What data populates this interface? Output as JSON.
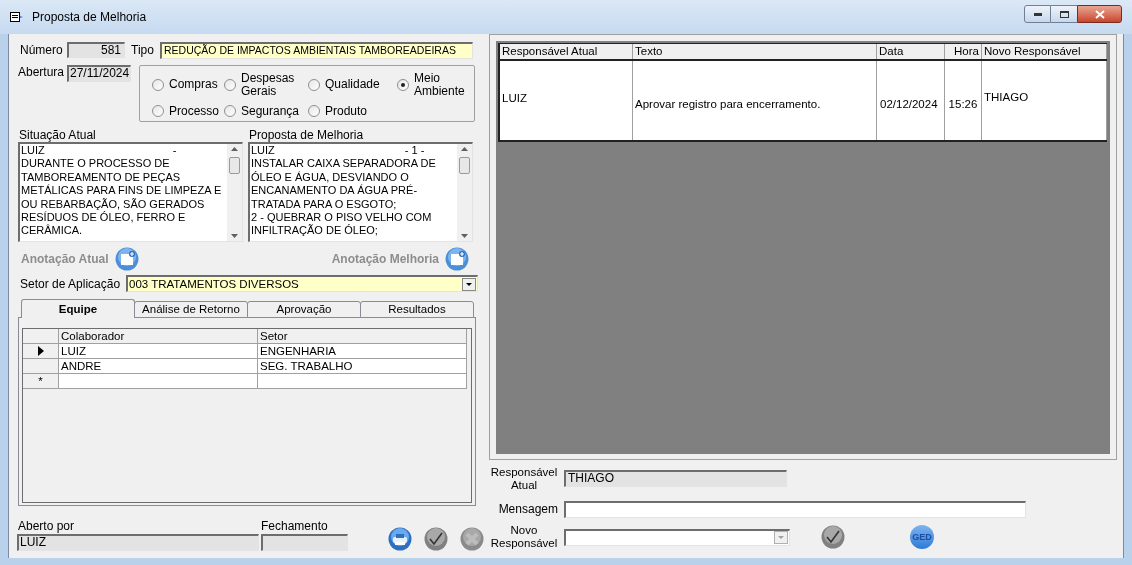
{
  "window": {
    "title": "Proposta de Melhoria"
  },
  "numero": {
    "label": "Número",
    "value": "581"
  },
  "tipo": {
    "label": "Tipo",
    "value": "REDUÇÃO DE IMPACTOS AMBIENTAIS TAMBOREADEIRAS"
  },
  "abertura": {
    "label": "Abertura",
    "value": "27/11/2024"
  },
  "categories": [
    {
      "label": "Compras",
      "selected": false
    },
    {
      "label": "Despesas Gerais",
      "selected": false
    },
    {
      "label": "Qualidade",
      "selected": false
    },
    {
      "label": "Meio Ambiente",
      "selected": true
    },
    {
      "label": "Processo",
      "selected": false
    },
    {
      "label": "Segurança",
      "selected": false
    },
    {
      "label": "Produto",
      "selected": false
    }
  ],
  "notes": [
    {
      "label": "Situação Atual",
      "author": "LUIZ",
      "marker": "-",
      "lines": [
        "DURANTE O PROCESSO DE",
        "TAMBOREAMENTO DE PEÇAS",
        "METÁLICAS PARA FINS DE LIMPEZA E",
        "OU REBARBAÇÃO, SÃO GERADOS",
        "RESÍDUOS DE ÓLEO, FERRO E",
        "CERÂMICA."
      ],
      "annotation": "Anotação Atual"
    },
    {
      "label": "Proposta de Melhoria",
      "author": "LUIZ",
      "marker": "- 1 -",
      "lines": [
        "INSTALAR CAIXA SEPARADORA DE",
        "ÓLEO E ÁGUA, DESVIANDO O",
        "ENCANAMENTO DA ÁGUA PRÉ-",
        "TRATADA PARA O ESGOTO;",
        "2 - QUEBRAR O PISO VELHO COM",
        "INFILTRAÇÃO DE ÓLEO;"
      ],
      "annotation": "Anotação Melhoria"
    }
  ],
  "setor": {
    "label": "Setor de Aplicação",
    "value": "003 TRATAMENTOS DIVERSOS"
  },
  "tabs": [
    {
      "label": "Equipe",
      "selected": true
    },
    {
      "label": "Análise de Retorno",
      "selected": false
    },
    {
      "label": "Aprovação",
      "selected": false
    },
    {
      "label": "Resultados",
      "selected": false
    }
  ],
  "team": {
    "columns": [
      "Colaborador",
      "Setor"
    ],
    "new_row_marker": "*",
    "rows": [
      {
        "colaborador": "LUIZ",
        "setor": "ENGENHARIA",
        "current": true
      },
      {
        "colaborador": "ANDRE",
        "setor": "SEG. TRABALHO",
        "current": false
      }
    ]
  },
  "aberto_por": {
    "label": "Aberto por",
    "value": "LUIZ"
  },
  "fechamento": {
    "label": "Fechamento"
  },
  "history": {
    "columns": [
      "Responsável Atual",
      "Texto",
      "Data",
      "Hora",
      "Novo Responsável"
    ],
    "rows": [
      {
        "responsavel": "LUIZ",
        "texto": "Aprovar registro para encerramento.",
        "data": "02/12/2024",
        "hora": "15:26",
        "novo": "THIAGO"
      }
    ]
  },
  "responsavel_atual": {
    "label": "Responsável Atual",
    "value": "THIAGO"
  },
  "mensagem": {
    "label": "Mensagem"
  },
  "novo_responsavel": {
    "label": "Novo Responsável"
  },
  "ged_button": {
    "label": "GED"
  }
}
